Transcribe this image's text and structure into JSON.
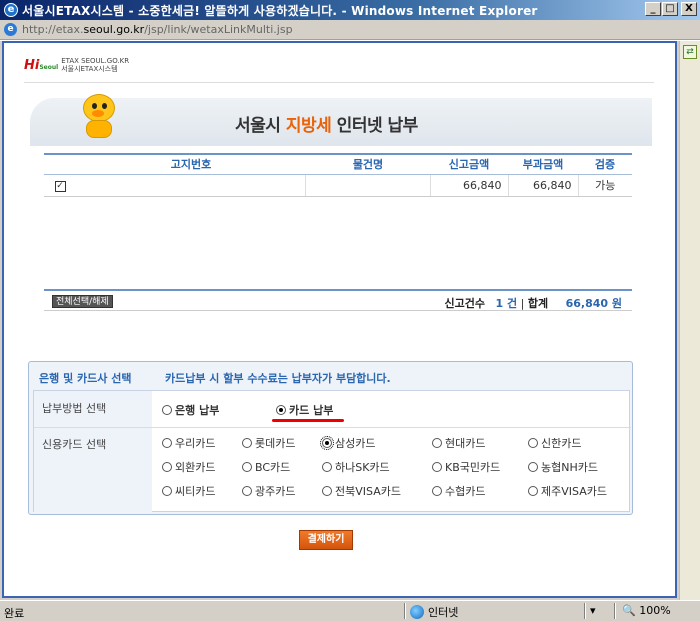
{
  "window": {
    "title": "서울시ETAX시스템 - 소중한세금! 알뜰하게 사용하겠습니다. - Windows Internet Explorer",
    "url_prefix": "http://etax.",
    "url_domain": "seoul.go.kr",
    "url_path": "/jsp/link/wetaxLinkMulti.jsp",
    "btn_minimize": "_",
    "btn_maximize": "□",
    "btn_close": "X"
  },
  "logo": {
    "hi": "Hi",
    "hi_sub": "Seoul",
    "line1": "ETAX SEOUL.GO.KR",
    "line2": "서울시ETAX시스템"
  },
  "banner": {
    "title_pre": "서울시 ",
    "title_highlight": "지방세",
    "title_post": " 인터넷 납부"
  },
  "table": {
    "headers": [
      "고지번호",
      "물건명",
      "신고금액",
      "부과금액",
      "검증"
    ],
    "rows": [
      {
        "notice_no": [
          "",
          "",
          "",
          "",
          ""
        ],
        "item": "",
        "report_amount": "66,840",
        "levy_amount": "66,840",
        "verify": "가능"
      }
    ]
  },
  "summary": {
    "select_all": "전체선택/해제",
    "count_label": "신고건수",
    "count_value": "1 건",
    "divider": "|",
    "total_label": "합계",
    "total_value": "66,840 원"
  },
  "payment": {
    "section_title": "은행 및 카드사 선택",
    "notice": "카드납부 시 할부 수수료는 납부자가 부담합니다.",
    "method_label": "납부방법 선택",
    "methods": [
      {
        "label": "은행 납부",
        "selected": false
      },
      {
        "label": "카드 납부",
        "selected": true
      }
    ],
    "card_label": "신용카드 선택",
    "cards": [
      {
        "label": "우리카드",
        "selected": false
      },
      {
        "label": "롯데카드",
        "selected": false
      },
      {
        "label": "삼성카드",
        "selected": true
      },
      {
        "label": "현대카드",
        "selected": false
      },
      {
        "label": "신한카드",
        "selected": false
      },
      {
        "label": "외환카드",
        "selected": false
      },
      {
        "label": "BC카드",
        "selected": false
      },
      {
        "label": "하나SK카드",
        "selected": false
      },
      {
        "label": "KB국민카드",
        "selected": false
      },
      {
        "label": "농협NH카드",
        "selected": false
      },
      {
        "label": "씨티카드",
        "selected": false
      },
      {
        "label": "광주카드",
        "selected": false
      },
      {
        "label": "전북VISA카드",
        "selected": false
      },
      {
        "label": "수협카드",
        "selected": false
      },
      {
        "label": "제주VISA카드",
        "selected": false
      }
    ],
    "pay_button": "결제하기"
  },
  "statusbar": {
    "status": "완료",
    "zone": "인터넷",
    "zoom": "100%",
    "ctl": "▾"
  },
  "colors": {
    "accent_blue": "#2a66b0",
    "highlight_orange": "#e8630a",
    "pay_button": "#e06a1a",
    "underline_red": "#e00000"
  }
}
